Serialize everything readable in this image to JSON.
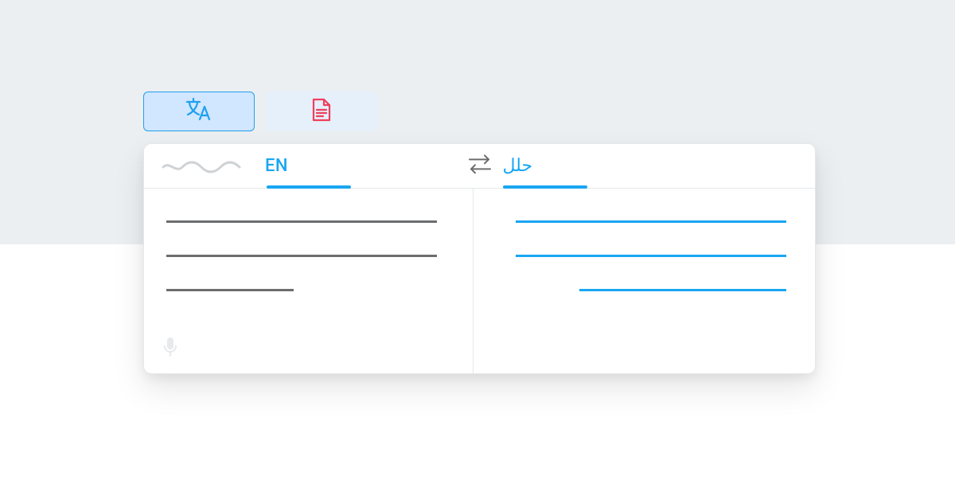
{
  "tabs": {
    "translate_icon": "translate-icon",
    "document_icon": "document-icon"
  },
  "source": {
    "lang_label": "EN"
  },
  "target": {
    "lang_label": "حلل"
  },
  "colors": {
    "accent": "#19a6f2",
    "doc_icon": "#ef3e5b",
    "src_text": "#6b6d6f"
  }
}
